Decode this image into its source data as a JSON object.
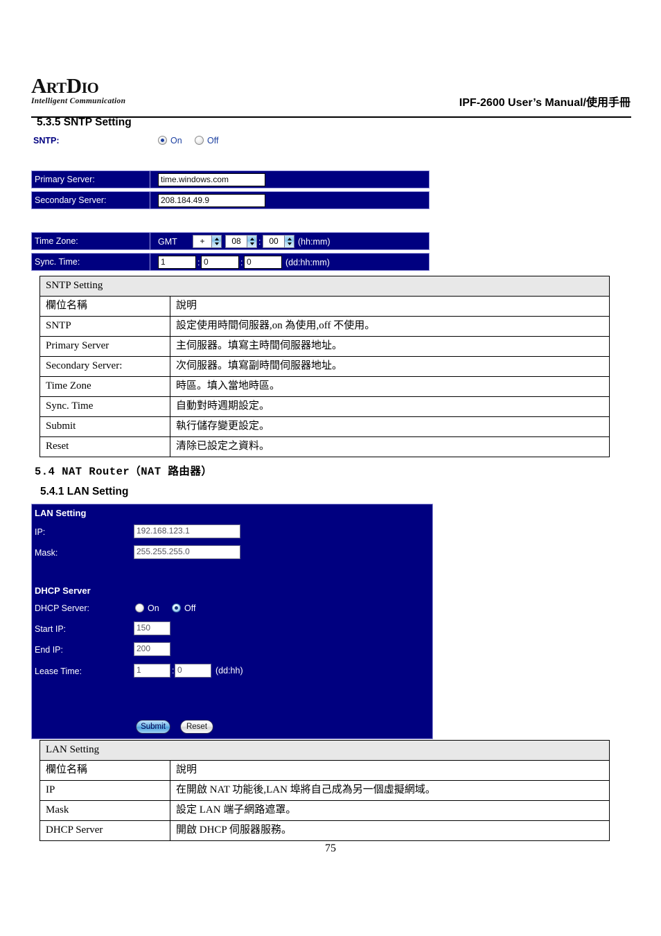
{
  "header": {
    "logo_main_a": "A",
    "logo_main_rt": "RT",
    "logo_main_d": "D",
    "logo_main_io": "IO",
    "logo_tagline": "Intelligent Communication",
    "manual_title": "IPF-2600 User’s Manual/使用手冊"
  },
  "sections": {
    "sntp_heading": "5.3.5 SNTP Setting",
    "nat_heading": "5.4 NAT Router（NAT 路由器）",
    "lan_heading": "5.4.1 LAN Setting"
  },
  "sntp_form": {
    "sntp_label": "SNTP:",
    "radio_on": "On",
    "radio_off": "Off",
    "sntp_selected": "On",
    "primary_label": "Primary Server:",
    "primary_value": "time.windows.com",
    "secondary_label": "Secondary Server:",
    "secondary_value": "208.184.49.9",
    "timezone_label": "Time Zone:",
    "gmt_text": "GMT",
    "tz_sign": "+",
    "tz_hh": "08",
    "tz_mm": "00",
    "tz_colon": ":",
    "tz_hint": "(hh:mm)",
    "sync_label": "Sync. Time:",
    "sync_dd": "1",
    "sync_hh": "0",
    "sync_mm": "0",
    "sync_sep_1": ":",
    "sync_sep_2": ":",
    "sync_hint": "(dd:hh:mm)"
  },
  "sntp_table": {
    "title": "SNTP Setting",
    "col_header_a": "欄位名稱",
    "col_header_b": "說明",
    "rows": [
      {
        "field": "SNTP",
        "desc": "設定使用時間伺服器,on 為使用,off 不使用。"
      },
      {
        "field": "Primary Server",
        "desc": "主伺服器。填寫主時間伺服器地址。"
      },
      {
        "field": "Secondary Server:",
        "desc": "次伺服器。填寫副時間伺服器地址。"
      },
      {
        "field": "Time Zone",
        "desc": "時區。填入當地時區。"
      },
      {
        "field": "Sync. Time",
        "desc": "自動對時週期設定。"
      },
      {
        "field": "Submit",
        "desc": "執行儲存變更設定。"
      },
      {
        "field": "Reset",
        "desc": "清除已設定之資料。"
      }
    ]
  },
  "lan_form": {
    "panel_title": "LAN Setting",
    "ip_label": "IP:",
    "ip_value": "192.168.123.1",
    "mask_label": "Mask:",
    "mask_value": "255.255.255.0",
    "dhcp_section_title": "DHCP Server",
    "dhcp_label": "DHCP Server:",
    "radio_on": "On",
    "radio_off": "Off",
    "dhcp_selected": "Off",
    "start_ip_label": "Start IP:",
    "start_ip_value": "150",
    "end_ip_label": "End IP:",
    "end_ip_value": "200",
    "lease_label": "Lease Time:",
    "lease_dd": "1",
    "lease_hh": "0",
    "lease_sep": ":",
    "lease_hint": "(dd:hh)",
    "submit_label": "Submit",
    "reset_label": "Reset"
  },
  "lan_table": {
    "title": "LAN Setting",
    "col_header_a": "欄位名稱",
    "col_header_b": "說明",
    "rows": [
      {
        "field": "IP",
        "desc": "在開啟 NAT 功能後,LAN 埠將自己成為另一個虛擬網域。"
      },
      {
        "field": "Mask",
        "desc": "設定 LAN 端子網路遮罩。"
      },
      {
        "field": "DHCP Server",
        "desc": "開啟 DHCP 伺服器服務。"
      }
    ]
  },
  "footer": {
    "page_number": "75"
  },
  "colors": {
    "panel_navy": "#000080",
    "panel_border": "#9c9ce0",
    "table_header_gray": "#e8e8e8",
    "link_navy": "#1b3fa0"
  }
}
